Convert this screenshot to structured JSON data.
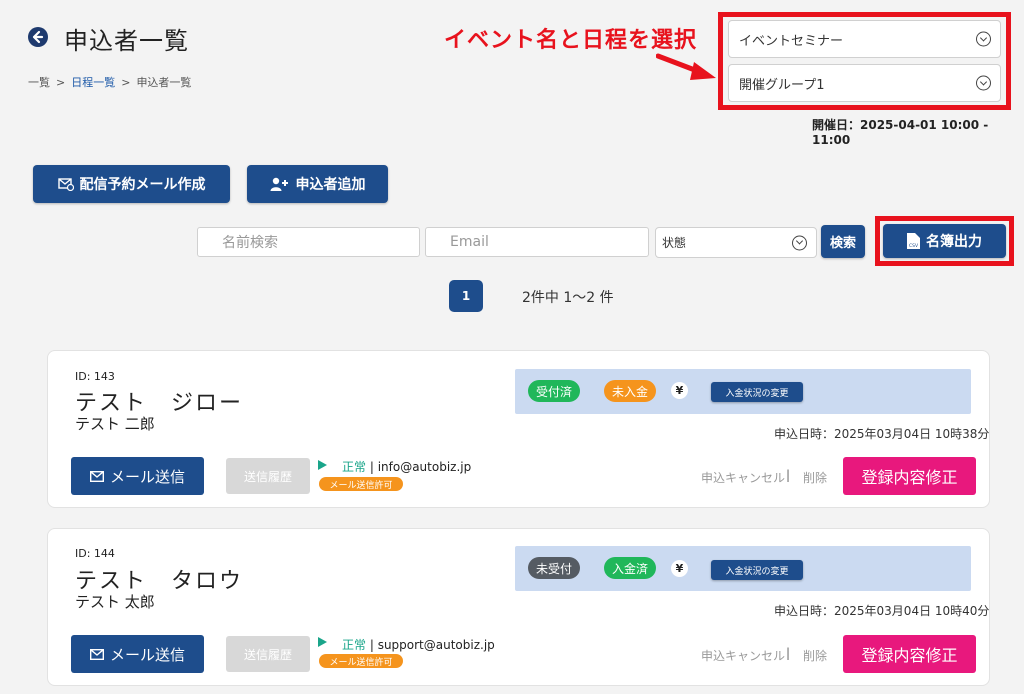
{
  "header": {
    "title": "申込者一覧",
    "breadcrumb": [
      "一覧",
      "日程一覧",
      "申込者一覧"
    ],
    "breadcrumb_sep": ">"
  },
  "annotation": {
    "text": "イベント名と日程を選択"
  },
  "selectors": {
    "event": "イベントセミナー",
    "group": "開催グループ1",
    "date_line": "開催日：2025-04-01 10:00 - 11:00"
  },
  "actions": {
    "schedule_mail": "配信予約メール作成",
    "add_applicant": "申込者追加"
  },
  "search": {
    "name_placeholder": "名前検索",
    "email_placeholder": "Email",
    "status_select": "状態",
    "search_button": "検索",
    "csv_button": "名簿出力"
  },
  "pagination": {
    "current": "1",
    "summary": "2件中 1～2 件"
  },
  "applicants": [
    {
      "id_label": "ID: 143",
      "name_kana": "テスト　ジロー",
      "name_kanji": "テスト 二郎",
      "reception": "受付済",
      "reception_color": "#20b75a",
      "payment": "未入金",
      "payment_color": "#f5941d",
      "yen": "¥",
      "change_payment": "入金状況の変更",
      "applied_at": "申込日時：2025年03月04日 10時38分",
      "mail_button": "メール送信",
      "history_button": "送信履歴",
      "mail_status_ok": "正常",
      "mail_status_email": " | info@autobiz.jp",
      "mail_permit": "メール送信許可",
      "cancel": "申込キャンセル",
      "delete": "削除",
      "edit": "登録内容修正"
    },
    {
      "id_label": "ID: 144",
      "name_kana": "テスト　タロウ",
      "name_kanji": "テスト 太郎",
      "reception": "未受付",
      "reception_color": "#555b63",
      "payment": "入金済",
      "payment_color": "#20b75a",
      "yen": "¥",
      "change_payment": "入金状況の変更",
      "applied_at": "申込日時：2025年03月04日 10時40分",
      "mail_button": "メール送信",
      "history_button": "送信履歴",
      "mail_status_ok": "正常",
      "mail_status_email": " | support@autobiz.jp",
      "mail_permit": "メール送信許可",
      "cancel": "申込キャンセル",
      "delete": "削除",
      "edit": "登録内容修正"
    }
  ]
}
